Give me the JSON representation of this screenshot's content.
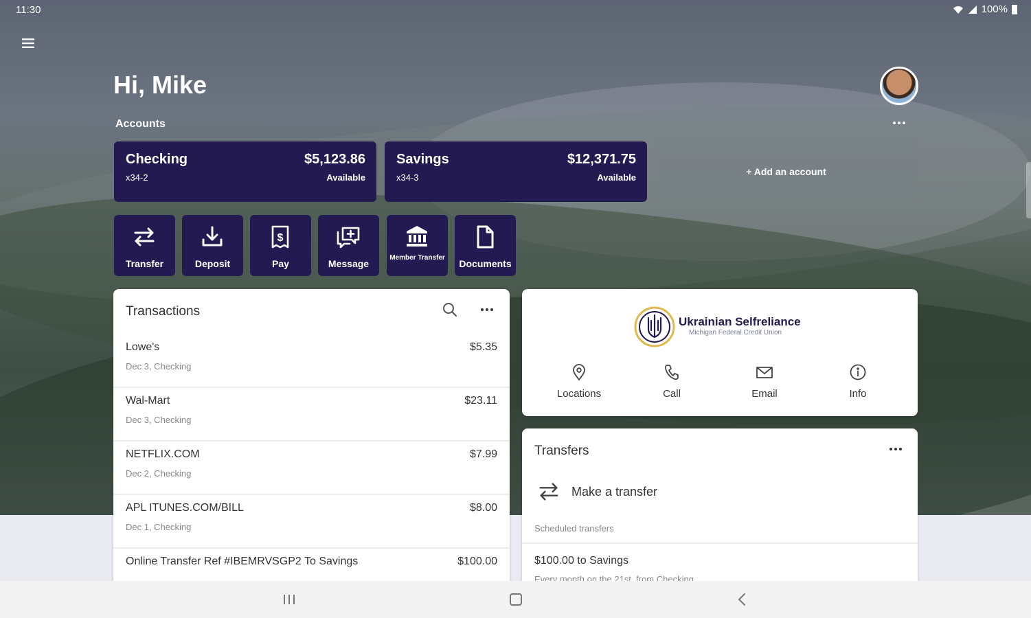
{
  "status_bar": {
    "time": "11:30",
    "battery": "100%"
  },
  "header": {
    "greeting": "Hi, Mike",
    "accounts_label": "Accounts"
  },
  "accounts": [
    {
      "name": "Checking",
      "number": "x34-2",
      "balance": "$5,123.86",
      "balance_label": "Available"
    },
    {
      "name": "Savings",
      "number": "x34-3",
      "balance": "$12,371.75",
      "balance_label": "Available"
    }
  ],
  "add_account_label": "+ Add an account",
  "quick_actions": [
    {
      "label": "Transfer",
      "icon": "transfer-icon"
    },
    {
      "label": "Deposit",
      "icon": "download-icon"
    },
    {
      "label": "Pay",
      "icon": "bill-icon"
    },
    {
      "label": "Message",
      "icon": "message-icon"
    },
    {
      "label": "Member Transfer",
      "icon": "bank-icon"
    },
    {
      "label": "Documents",
      "icon": "document-icon"
    }
  ],
  "transactions": {
    "title": "Transactions",
    "items": [
      {
        "merchant": "Lowe's",
        "meta": "Dec 3, Checking",
        "amount": "$5.35"
      },
      {
        "merchant": "Wal-Mart",
        "meta": "Dec 3, Checking",
        "amount": "$23.11"
      },
      {
        "merchant": "NETFLIX.COM",
        "meta": "Dec 2, Checking",
        "amount": "$7.99"
      },
      {
        "merchant": "APL ITUNES.COM/BILL",
        "meta": "Dec 1, Checking",
        "amount": "$8.00"
      },
      {
        "merchant": "Online Transfer Ref #IBEMRVSGP2 To Savings",
        "meta": "",
        "amount": "$100.00"
      }
    ]
  },
  "credit_union": {
    "name": "Ukrainian Selfreliance",
    "subtitle": "Michigan Federal Credit Union",
    "actions": [
      {
        "label": "Locations",
        "icon": "location-pin-icon"
      },
      {
        "label": "Call",
        "icon": "phone-icon"
      },
      {
        "label": "Email",
        "icon": "mail-icon"
      },
      {
        "label": "Info",
        "icon": "info-icon"
      }
    ]
  },
  "transfers": {
    "title": "Transfers",
    "make_label": "Make a transfer",
    "scheduled_label": "Scheduled transfers",
    "scheduled": [
      {
        "title": "$100.00 to Savings",
        "subtitle": "Every month on the 21st, from Checking"
      }
    ]
  },
  "colors": {
    "brand": "#241a52",
    "card_bg": "#ffffff",
    "bottom_bg": "#e9ebf0"
  }
}
